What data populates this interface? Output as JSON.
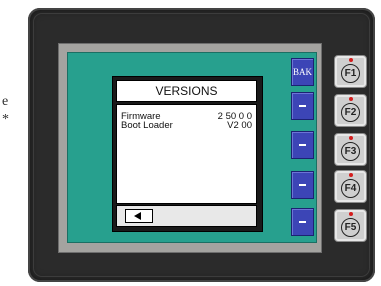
{
  "side_text": [
    "e",
    "*"
  ],
  "dialog": {
    "title": "VERSIONS",
    "rows": [
      {
        "label": "Firmware",
        "value": "2 50 0 0"
      },
      {
        "label": "Boot Loader",
        "value": "V2 00"
      }
    ]
  },
  "softkeys": {
    "bak_label": "BAK"
  },
  "function_keys": [
    "F1",
    "F2",
    "F3",
    "F4",
    "F5"
  ],
  "colors": {
    "screen": "#27a08e",
    "softkey": "#3c45b6",
    "led": "#d41d1d"
  }
}
